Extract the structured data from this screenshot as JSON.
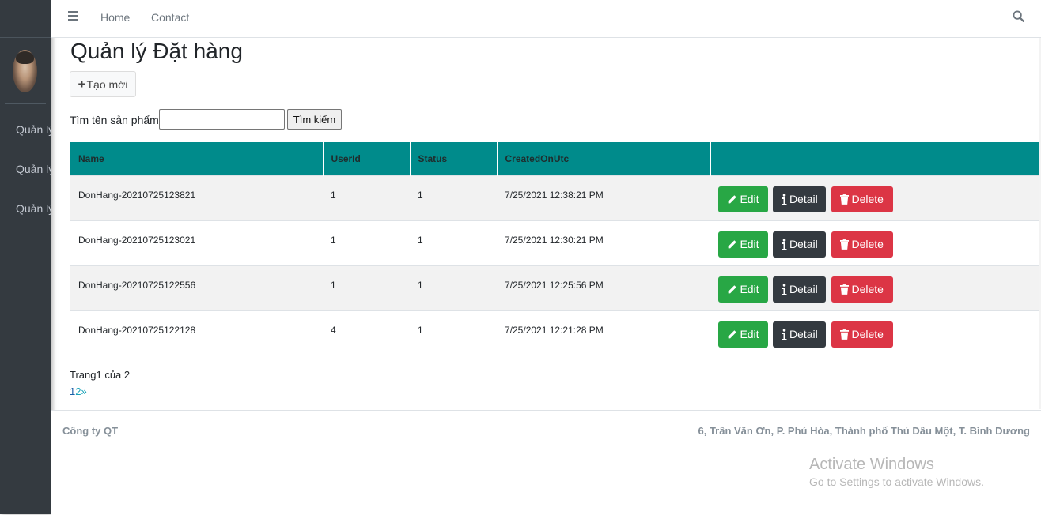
{
  "nav": {
    "home": "Home",
    "contact": "Contact"
  },
  "sidebar": {
    "items": [
      {
        "label": "Quản lý"
      },
      {
        "label": "Quản lý"
      },
      {
        "label": "Quản lý"
      }
    ]
  },
  "page": {
    "title": "Quản lý Đặt hàng",
    "create_label": "Tạo mới",
    "search_label": "Tìm tên sản phẩm:",
    "search_value": "",
    "search_button": "Tìm kiếm"
  },
  "table": {
    "headers": [
      "Name",
      "UserId",
      "Status",
      "CreatedOnUtc",
      ""
    ],
    "rows": [
      {
        "name": "DonHang-20210725123821",
        "userid": "1",
        "status": "1",
        "created": "7/25/2021 12:38:21 PM"
      },
      {
        "name": "DonHang-20210725123021",
        "userid": "1",
        "status": "1",
        "created": "7/25/2021 12:30:21 PM"
      },
      {
        "name": "DonHang-20210725122556",
        "userid": "1",
        "status": "1",
        "created": "7/25/2021 12:25:56 PM"
      },
      {
        "name": "DonHang-20210725122128",
        "userid": "4",
        "status": "1",
        "created": "7/25/2021 12:21:28 PM"
      }
    ],
    "actions": {
      "edit": "Edit",
      "detail": "Detail",
      "delete": "Delete"
    }
  },
  "pagination": {
    "text": "Trang1 của 2",
    "pages": [
      "1",
      "2"
    ],
    "next": "»"
  },
  "footer": {
    "company": "Công ty QT",
    "address": "6, Trần Văn Ơn, P. Phú Hòa, Thành phố Thủ Dầu Một, T. Bình Dương"
  },
  "watermark": {
    "line1": "Activate Windows",
    "line2": "Go to Settings to activate Windows."
  },
  "colors": {
    "header_bg": "#008b8b",
    "edit": "#28a745",
    "detail": "#343a40",
    "delete": "#dc3545",
    "sidebar": "#343a40"
  },
  "icons": {
    "menu": "hamburger-icon",
    "search": "search-icon",
    "create": "plus-icon",
    "edit": "pencil-icon",
    "detail": "info-icon",
    "delete": "trash-icon"
  }
}
